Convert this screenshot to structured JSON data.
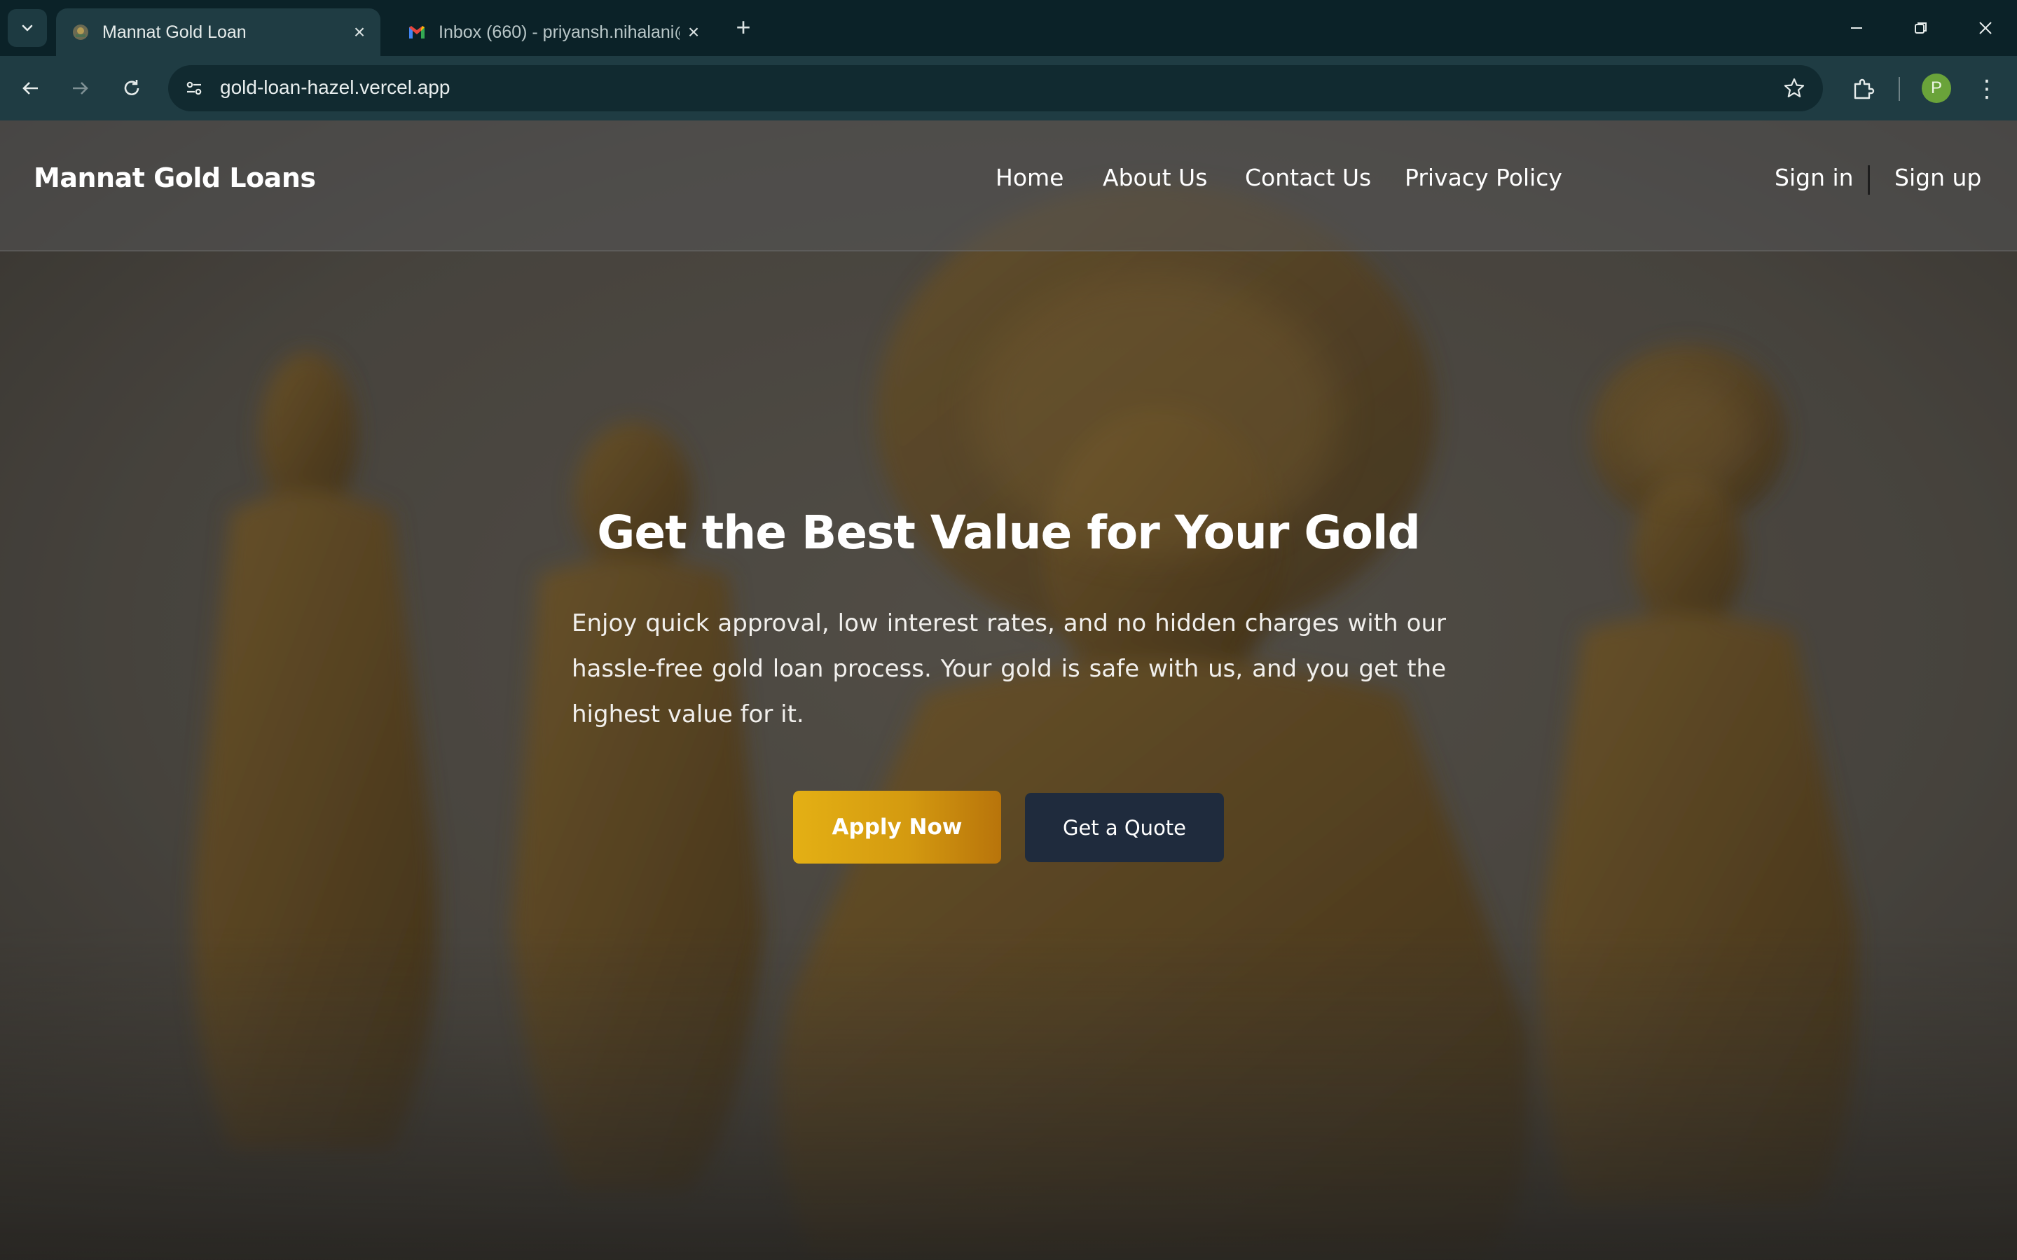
{
  "browser": {
    "tabs": [
      {
        "title": "Mannat Gold Loan",
        "active": true,
        "icon": "site-favicon"
      },
      {
        "title": "Inbox (660) - priyansh.nihalani@",
        "active": false,
        "icon": "gmail-icon"
      }
    ],
    "url": "gold-loan-hazel.vercel.app",
    "profile_initial": "P",
    "colors": {
      "tabstrip": "#0b2228",
      "toolbar": "#1f3c43",
      "omnibox": "#112a30",
      "profile": "#6aa33a"
    }
  },
  "site": {
    "brand": "Mannat Gold Loans",
    "nav": {
      "home": "Home",
      "about": "About Us",
      "contact": "Contact Us",
      "privacy": "Privacy Policy"
    },
    "auth": {
      "sign_in": "Sign in",
      "sign_up": "Sign up"
    }
  },
  "hero": {
    "title": "Get the Best Value for Your Gold",
    "text": "Enjoy quick approval, low interest rates, and no hidden charges with our hassle-free gold loan process. Your gold is safe with us, and you get the highest value for it.",
    "primary_cta": "Apply Now",
    "secondary_cta": "Get a Quote",
    "colors": {
      "primary_start": "#e4b014",
      "primary_end": "#b8740b",
      "secondary": "#1f2b3d"
    },
    "background": "blurred-gold-statues-photo"
  }
}
